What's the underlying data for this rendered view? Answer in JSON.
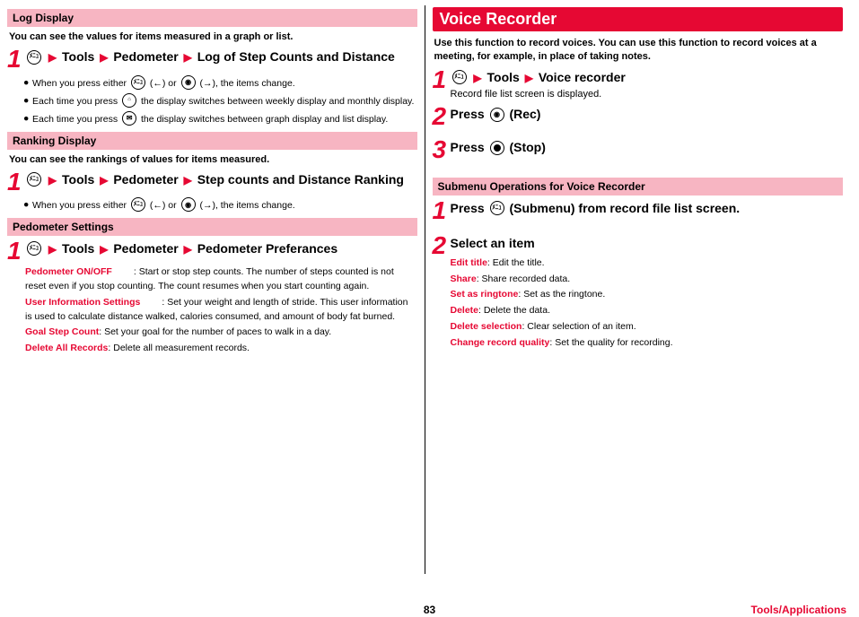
{
  "left": {
    "logDisplay": {
      "heading": "Log Display",
      "lead": "You can see the values for items measured in a graph or list.",
      "step1": {
        "pre": "Tools",
        "mid1": "Pedometer",
        "mid2": "Log of Step Counts and Distance"
      },
      "bullets": {
        "b1a": "When you press either ",
        "b1b": " (←) or ",
        "b1c": " (→), the items change.",
        "b2a": "Each time you press ",
        "b2b": " the display switches between weekly display and monthly display.",
        "b3a": "Each time you press ",
        "b3b": " the display switches between graph display and list display."
      }
    },
    "ranking": {
      "heading": "Ranking Display",
      "lead": "You can see the rankings of values for items measured.",
      "step1": {
        "pre": "Tools",
        "mid1": "Pedometer",
        "mid2": "Step counts and Distance Ranking"
      },
      "bullet": {
        "a": "When you press either ",
        "b": " (←) or ",
        "c": " (→), the items change."
      }
    },
    "settings": {
      "heading": "Pedometer Settings",
      "step1": {
        "pre": "Tools",
        "mid1": "Pedometer",
        "mid2": "Pedometer Preferances"
      },
      "defs": {
        "d1t": "Pedometer ON/OFF",
        "d1d": ": Start or stop step counts. The number of steps counted is not reset even if you stop counting. The count resumes when you start counting again.",
        "d2t": "User Information Settings",
        "d2d": ": Set your weight and length of stride. This user information is used to calculate distance walked, calories consumed, and amount of body fat burned.",
        "d3t": "Goal Step Count",
        "d3d": ": Set your goal for the number of paces to walk in a day.",
        "d4t": "Delete All Records",
        "d4d": ": Delete all measurement records."
      }
    }
  },
  "right": {
    "vr": {
      "heading": "Voice Recorder",
      "lead": "Use this function to record voices. You can use this function to record voices at a meeting, for example, in place of taking notes.",
      "s1": {
        "pre": "Tools",
        "mid": "Voice recorder",
        "note": "Record file list screen is displayed."
      },
      "s2": {
        "pre": "Press ",
        "post": " (Rec)"
      },
      "s3": {
        "pre": "Press ",
        "post": " (Stop)"
      }
    },
    "submenu": {
      "heading": "Submenu Operations for Voice Recorder",
      "s1": {
        "pre": "Press ",
        "post": " (Submenu) from record file list screen."
      },
      "s2": {
        "title": "Select an item"
      },
      "defs": {
        "d1t": "Edit title",
        "d1d": ": Edit the title.",
        "d2t": "Share",
        "d2d": ": Share recorded data.",
        "d3t": "Set as ringtone",
        "d3d": ": Set as the ringtone.",
        "d4t": "Delete",
        "d4d": ": Delete the data.",
        "d5t": "Delete selection",
        "d5d": ": Clear selection of an item.",
        "d6t": "Change record quality",
        "d6d": ": Set the quality for recording."
      }
    }
  },
  "footer": {
    "page": "83",
    "chapter": "Tools/Applications"
  },
  "icons": {
    "menu": "ﾒﾆｭ",
    "camera": "📷",
    "mail": "✉",
    "tv": "TV"
  }
}
